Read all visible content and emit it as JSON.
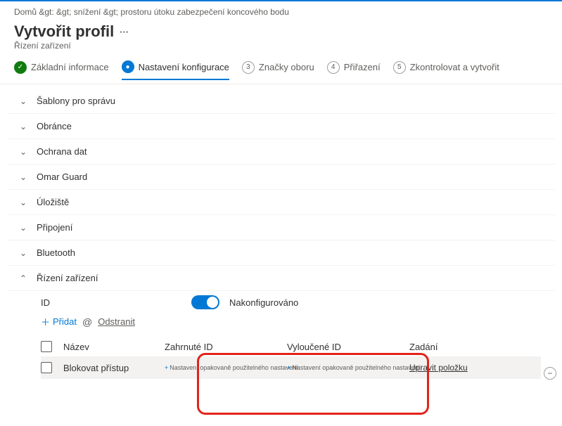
{
  "breadcrumb": "Domů &gt:   &gt; snížení &gt; prostoru útoku zabezpečení koncového bodu",
  "title": "Vytvořit profil",
  "subtitle": "Řízení zařízení",
  "steps": {
    "s1": "Základní informace",
    "s2": "Nastavení konfigurace",
    "s3": "Značky oboru",
    "s4": "Přiřazení",
    "s5": "Zkontrolovat a vytvořit",
    "n3": "3",
    "n4": "4",
    "n5": "5"
  },
  "sections": {
    "admin_templates": "Šablony pro správu",
    "defender": "Obránce",
    "data_protection": "Ochrana dat",
    "omar_guard": "Omar Guard",
    "storage": "Úložiště",
    "connectivity": "Připojení",
    "bluetooth": "Bluetooth",
    "device_control": "Řízení zařízení"
  },
  "device_control": {
    "id_label": "ID",
    "configured": "Nakonfigurováno",
    "add": "Přidat",
    "remove": "Odstranit",
    "headers": {
      "name": "Název",
      "included": "Zahrnuté ID",
      "excluded": "Vyloučené ID",
      "entry": "Zadání"
    },
    "row": {
      "name": "Blokovat přístup",
      "included_hint": "Nastavení opakovaně použitelného nastavení",
      "excluded_hint": "Nastavení opakovaně použitelného nastavení",
      "edit": "Upravit položku"
    }
  }
}
